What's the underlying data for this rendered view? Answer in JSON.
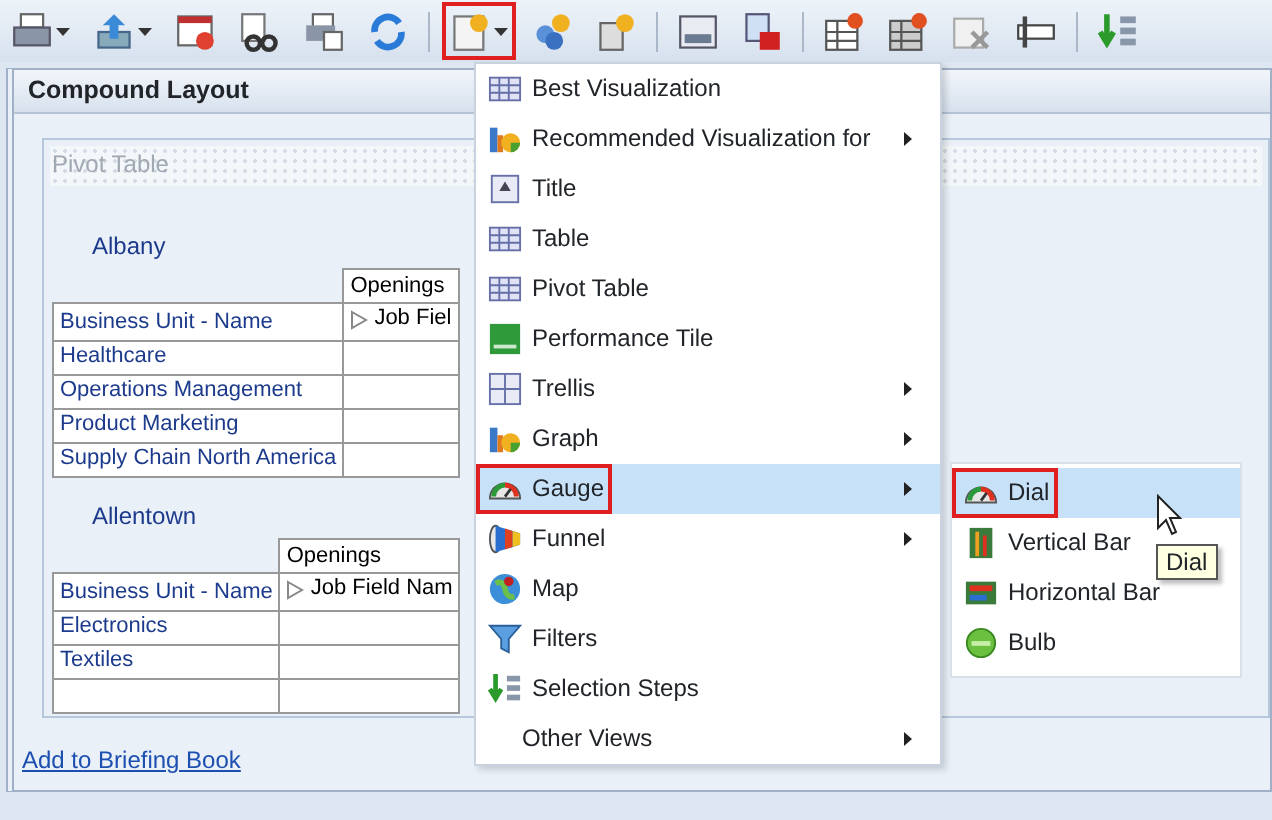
{
  "toolbar": {
    "buttons": [
      {
        "kind": "button",
        "dropdown": true,
        "highlighted": false
      },
      {
        "kind": "button",
        "dropdown": true,
        "highlighted": false
      },
      {
        "kind": "button",
        "dropdown": false,
        "highlighted": false
      },
      {
        "kind": "button",
        "dropdown": false,
        "highlighted": false
      },
      {
        "kind": "button",
        "dropdown": false,
        "highlighted": false
      },
      {
        "kind": "button",
        "dropdown": false,
        "highlighted": false
      },
      {
        "kind": "separator"
      },
      {
        "kind": "button",
        "dropdown": true,
        "highlighted": true
      },
      {
        "kind": "button",
        "dropdown": false,
        "highlighted": false
      },
      {
        "kind": "button",
        "dropdown": false,
        "highlighted": false
      },
      {
        "kind": "separator"
      },
      {
        "kind": "button",
        "dropdown": false,
        "highlighted": false
      },
      {
        "kind": "button",
        "dropdown": false,
        "highlighted": false
      },
      {
        "kind": "separator"
      },
      {
        "kind": "button",
        "dropdown": false,
        "highlighted": false
      },
      {
        "kind": "button",
        "dropdown": false,
        "highlighted": false
      },
      {
        "kind": "button",
        "dropdown": false,
        "highlighted": false
      },
      {
        "kind": "button",
        "dropdown": false,
        "highlighted": false
      },
      {
        "kind": "separator"
      },
      {
        "kind": "button",
        "dropdown": false,
        "highlighted": false
      }
    ]
  },
  "panel": {
    "title": "Compound Layout",
    "view_title": "Pivot Table",
    "sections": [
      {
        "heading": "Albany",
        "column_header": "Openings",
        "row_header": "Business Unit - Name",
        "column_field": "Job Fiel",
        "rows": [
          "Healthcare",
          "Operations Management",
          "Product Marketing",
          "Supply Chain North America"
        ],
        "trailing_blank_row": false
      },
      {
        "heading": "Allentown",
        "column_header": "Openings",
        "row_header": "Business Unit - Name",
        "column_field": "Job Field Nam",
        "rows": [
          "Electronics",
          "Textiles"
        ],
        "trailing_blank_row": true
      }
    ]
  },
  "link": "Add to Briefing Book",
  "menu": {
    "items": [
      {
        "label": "Best Visualization",
        "submenu": false,
        "selected": false,
        "highlighted": false
      },
      {
        "label": "Recommended Visualization for",
        "submenu": true,
        "selected": false,
        "highlighted": false
      },
      {
        "label": "Title",
        "submenu": false,
        "selected": false,
        "highlighted": false
      },
      {
        "label": "Table",
        "submenu": false,
        "selected": false,
        "highlighted": false
      },
      {
        "label": "Pivot Table",
        "submenu": false,
        "selected": false,
        "highlighted": false
      },
      {
        "label": "Performance Tile",
        "submenu": false,
        "selected": false,
        "highlighted": false
      },
      {
        "label": "Trellis",
        "submenu": true,
        "selected": false,
        "highlighted": false
      },
      {
        "label": "Graph",
        "submenu": true,
        "selected": false,
        "highlighted": false
      },
      {
        "label": "Gauge",
        "submenu": true,
        "selected": true,
        "highlighted": true
      },
      {
        "label": "Funnel",
        "submenu": true,
        "selected": false,
        "highlighted": false
      },
      {
        "label": "Map",
        "submenu": false,
        "selected": false,
        "highlighted": false
      },
      {
        "label": "Filters",
        "submenu": false,
        "selected": false,
        "highlighted": false
      },
      {
        "label": "Selection Steps",
        "submenu": false,
        "selected": false,
        "highlighted": false
      },
      {
        "label": "Other Views",
        "submenu": true,
        "selected": false,
        "highlighted": false
      }
    ]
  },
  "submenu": {
    "items": [
      {
        "label": "Dial",
        "selected": true,
        "highlighted": true
      },
      {
        "label": "Vertical Bar",
        "selected": false,
        "highlighted": false
      },
      {
        "label": "Horizontal Bar",
        "selected": false,
        "highlighted": false
      },
      {
        "label": "Bulb",
        "selected": false,
        "highlighted": false
      }
    ]
  },
  "tooltip": "Dial"
}
